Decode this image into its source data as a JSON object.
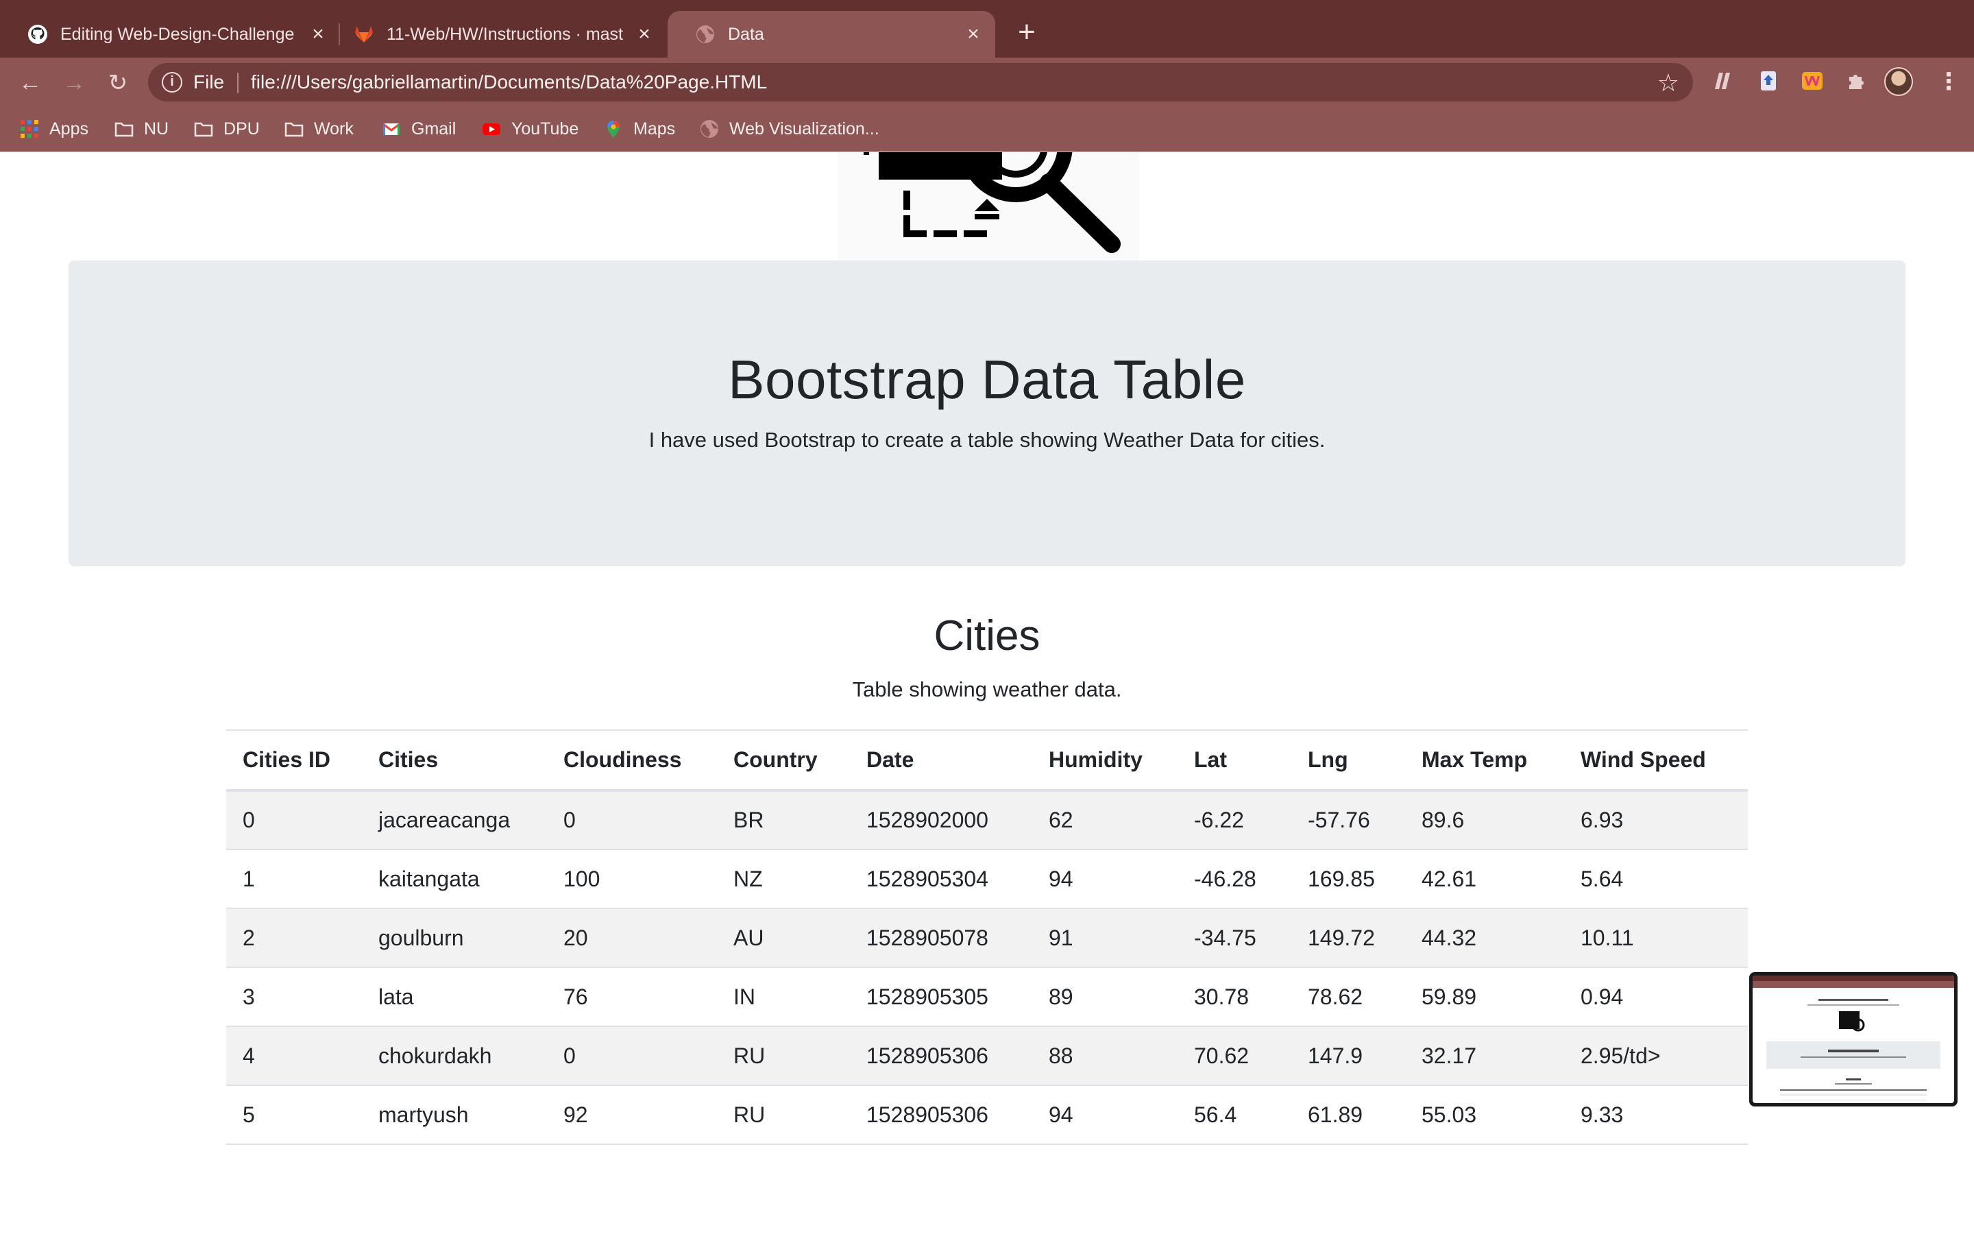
{
  "browser": {
    "tabs": [
      {
        "title": "Editing Web-Design-Challenge",
        "active": false,
        "icon": "github-icon"
      },
      {
        "title": "11-Web/HW/Instructions · mast",
        "active": false,
        "icon": "gitlab-icon"
      },
      {
        "title": "Data",
        "active": true,
        "icon": "globe-icon"
      }
    ],
    "new_tab_label": "+",
    "omnibox": {
      "scheme_label": "File",
      "url": "file:///Users/gabriellamartin/Documents/Data%20Page.HTML"
    },
    "bookmarks": [
      {
        "label": "Apps",
        "icon": "apps-grid-icon"
      },
      {
        "label": "NU",
        "icon": "folder-icon"
      },
      {
        "label": "DPU",
        "icon": "folder-icon"
      },
      {
        "label": "Work",
        "icon": "folder-icon"
      },
      {
        "label": "Gmail",
        "icon": "gmail-icon"
      },
      {
        "label": "YouTube",
        "icon": "youtube-icon"
      },
      {
        "label": "Maps",
        "icon": "maps-icon"
      },
      {
        "label": "Web Visualization...",
        "icon": "globe-icon"
      }
    ],
    "colors": {
      "tabstrip": "#62302f",
      "toolbar": "#8d5655",
      "omnibox": "#6f3c3b"
    }
  },
  "page": {
    "jumbotron": {
      "title": "Bootstrap Data Table",
      "lead": "I have used Bootstrap to create a table showing Weather Data for cities."
    },
    "section": {
      "title": "Cities",
      "subtitle": "Table showing weather data."
    },
    "table": {
      "headers": [
        "Cities ID",
        "Cities",
        "Cloudiness",
        "Country",
        "Date",
        "Humidity",
        "Lat",
        "Lng",
        "Max Temp",
        "Wind Speed"
      ],
      "rows": [
        [
          "0",
          "jacareacanga",
          "0",
          "BR",
          "1528902000",
          "62",
          "-6.22",
          "-57.76",
          "89.6",
          "6.93"
        ],
        [
          "1",
          "kaitangata",
          "100",
          "NZ",
          "1528905304",
          "94",
          "-46.28",
          "169.85",
          "42.61",
          "5.64"
        ],
        [
          "2",
          "goulburn",
          "20",
          "AU",
          "1528905078",
          "91",
          "-34.75",
          "149.72",
          "44.32",
          "10.11"
        ],
        [
          "3",
          "lata",
          "76",
          "IN",
          "1528905305",
          "89",
          "30.78",
          "78.62",
          "59.89",
          "0.94"
        ],
        [
          "4",
          "chokurdakh",
          "0",
          "RU",
          "1528905306",
          "88",
          "70.62",
          "147.9",
          "32.17",
          "2.95/td>"
        ],
        [
          "5",
          "martyush",
          "92",
          "RU",
          "1528905306",
          "94",
          "56.4",
          "61.89",
          "55.03",
          "9.33"
        ]
      ]
    }
  }
}
